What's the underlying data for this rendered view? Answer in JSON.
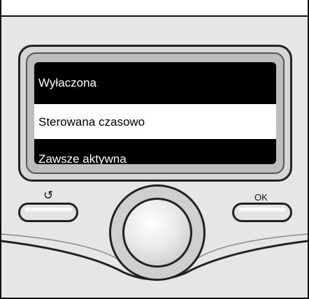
{
  "menu": {
    "items": [
      {
        "label": "Wyłaczona",
        "selected": false
      },
      {
        "label": "Sterowana czasowo",
        "selected": true
      },
      {
        "label": "Zawsze aktywna",
        "selected": false
      }
    ]
  },
  "buttons": {
    "back_icon": "↺",
    "ok_label": "OK"
  }
}
